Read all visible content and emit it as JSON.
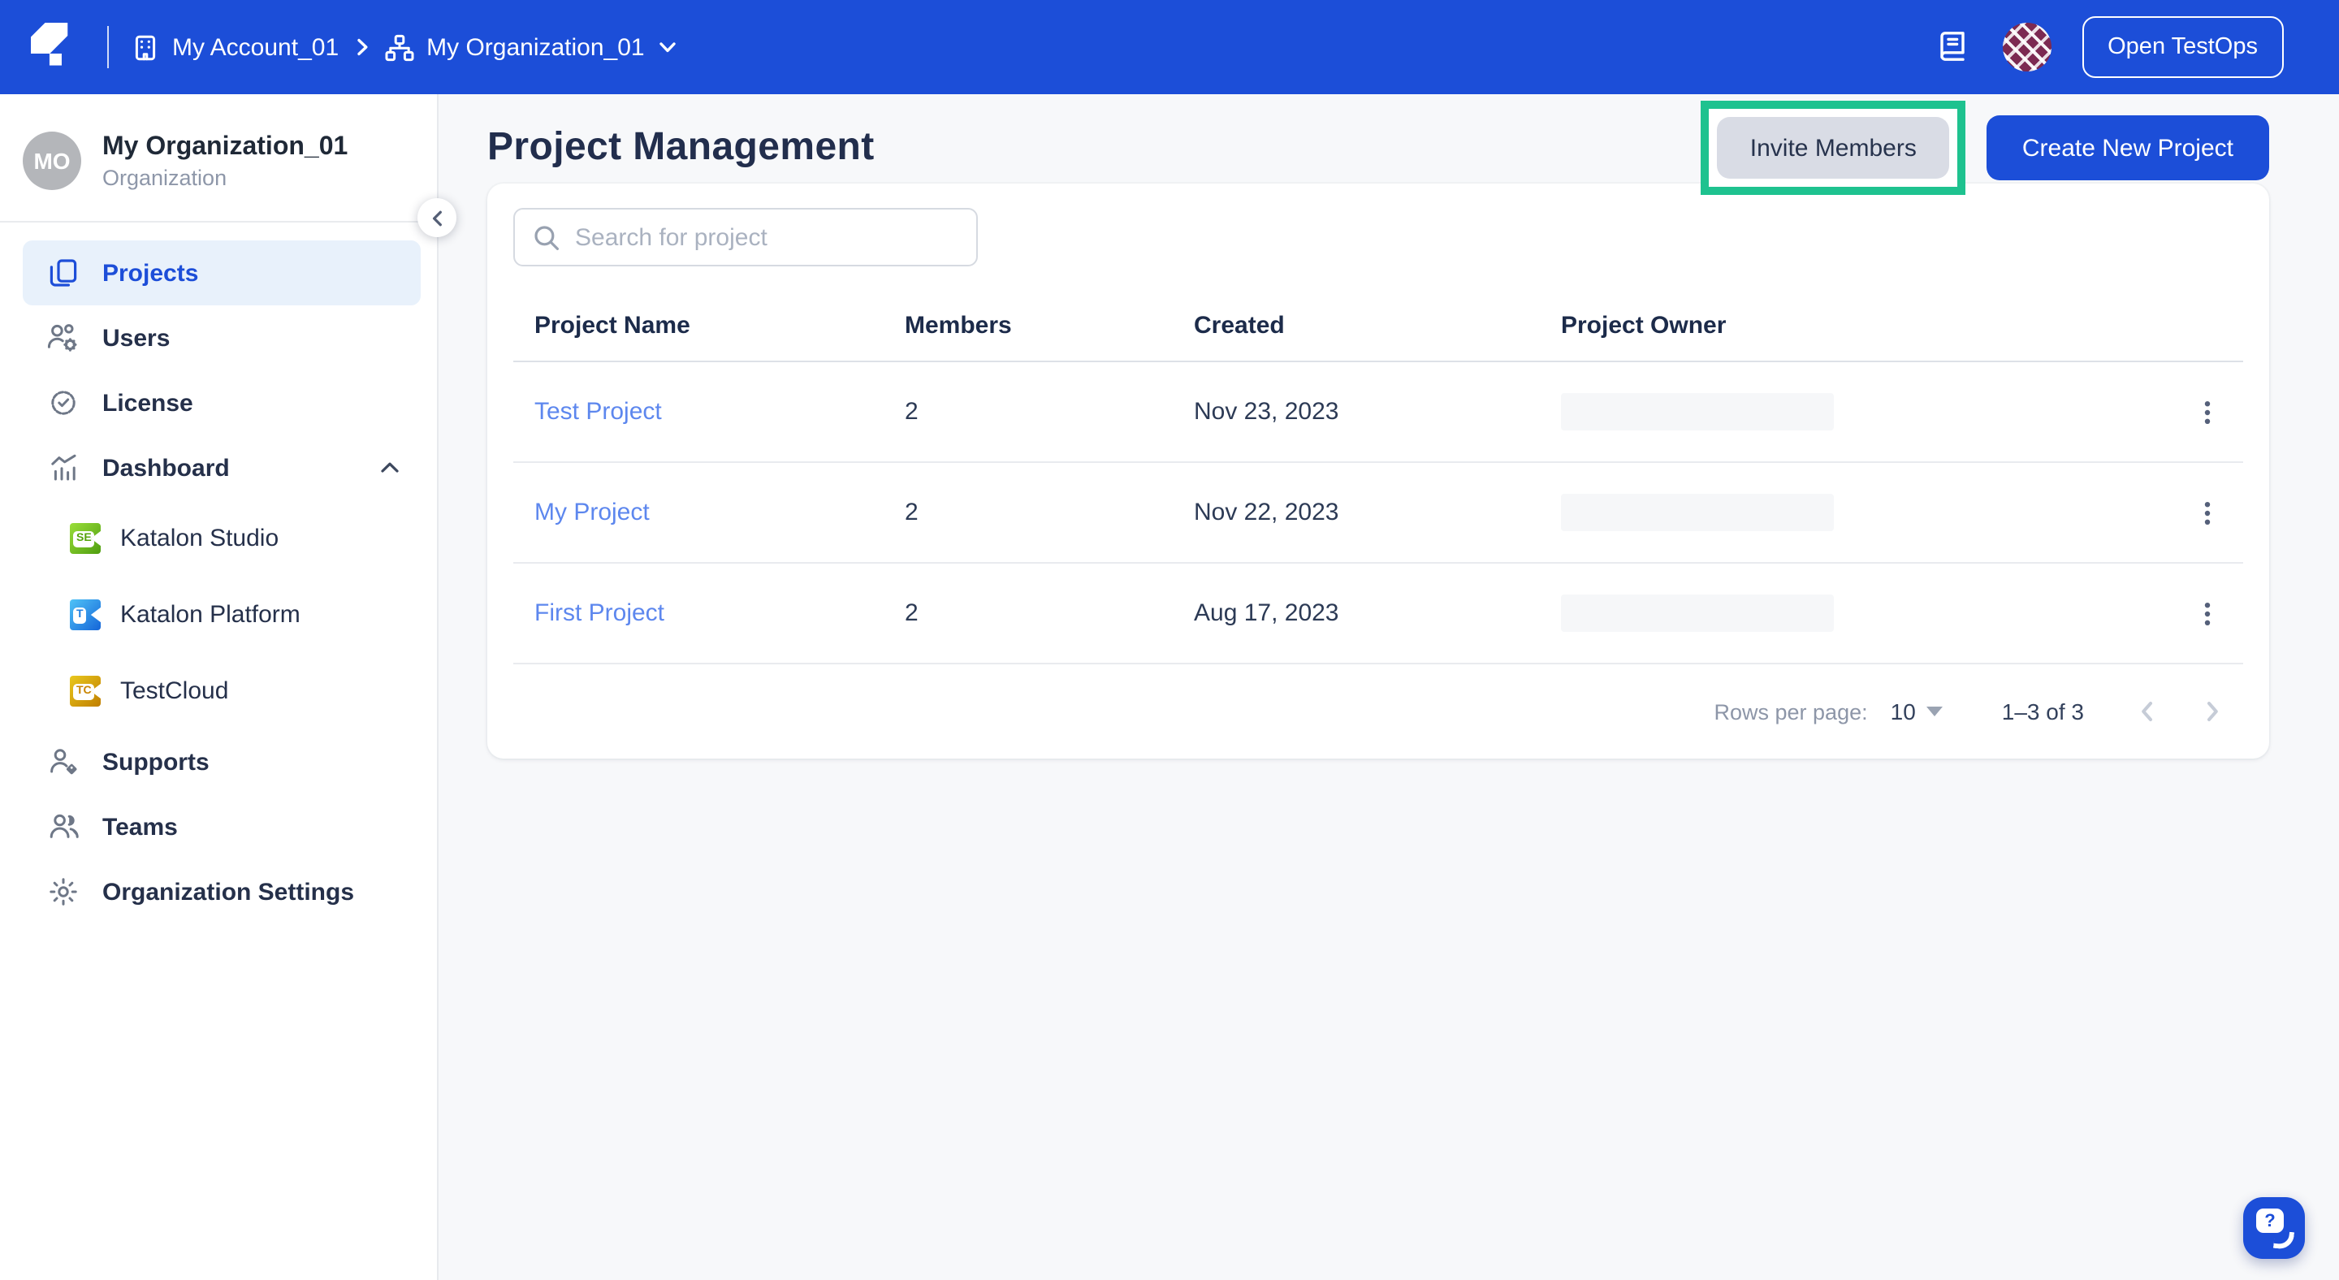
{
  "topbar": {
    "account_label": "My Account_01",
    "organization_label": "My Organization_01",
    "open_testops_label": "Open TestOps"
  },
  "sidebar": {
    "avatar_initials": "MO",
    "org_name": "My Organization_01",
    "org_type": "Organization",
    "items": [
      {
        "label": "Projects"
      },
      {
        "label": "Users"
      },
      {
        "label": "License"
      },
      {
        "label": "Dashboard"
      },
      {
        "label": "Supports"
      },
      {
        "label": "Teams"
      },
      {
        "label": "Organization Settings"
      }
    ],
    "dashboard_children": [
      {
        "label": "Katalon Studio",
        "badge": "SE"
      },
      {
        "label": "Katalon Platform",
        "badge": "T"
      },
      {
        "label": "TestCloud",
        "badge": "TC"
      }
    ]
  },
  "main": {
    "title": "Project Management",
    "invite_members_label": "Invite Members",
    "create_project_label": "Create New Project",
    "search_placeholder": "Search for project",
    "table": {
      "columns": [
        "Project Name",
        "Members",
        "Created",
        "Project Owner"
      ],
      "rows": [
        {
          "name": "Test Project",
          "members": "2",
          "created": "Nov 23, 2023"
        },
        {
          "name": "My Project",
          "members": "2",
          "created": "Nov 22, 2023"
        },
        {
          "name": "First Project",
          "members": "2",
          "created": "Aug 17, 2023"
        }
      ]
    },
    "pagination": {
      "rows_per_page_label": "Rows per page:",
      "rows_per_page_value": "10",
      "range_label": "1–3 of 3"
    }
  },
  "help": {
    "glyph": "?"
  },
  "colors": {
    "topbar_blue": "#1c4ed8",
    "primary_button_blue": "#1c4ed8",
    "highlight_green": "#1ec28f",
    "link_blue": "#5d87ee",
    "selected_item_bg": "#e8f1fb"
  }
}
